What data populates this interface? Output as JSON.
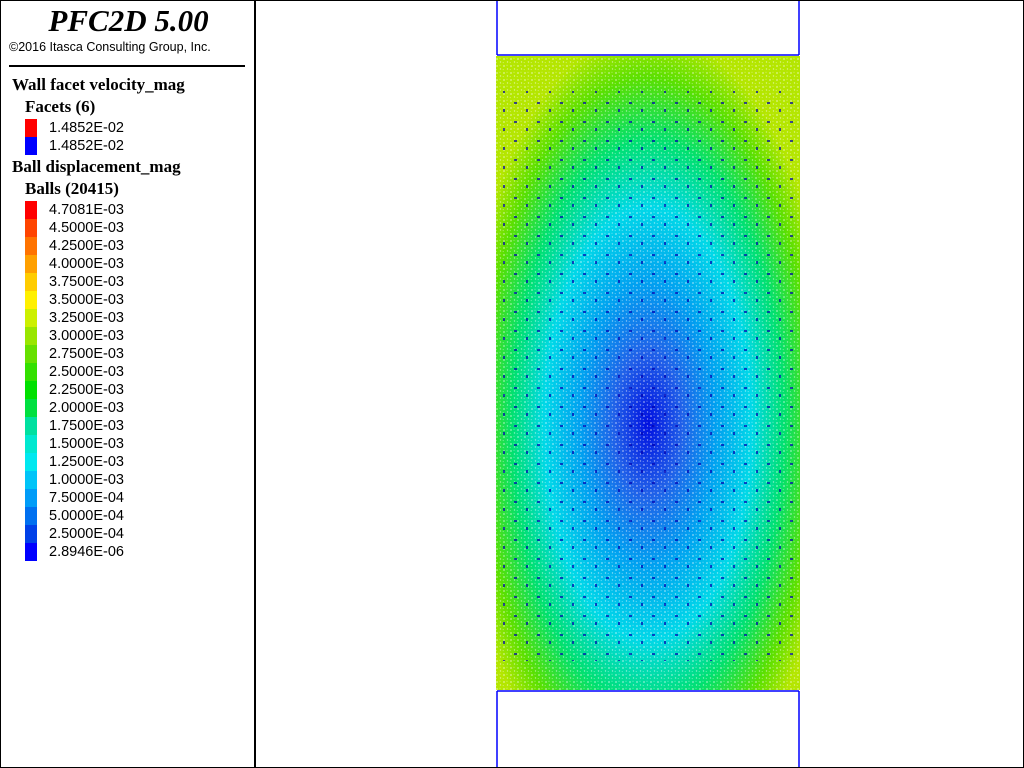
{
  "app": {
    "title": "PFC2D 5.00",
    "copyright": "©2016 Itasca Consulting Group, Inc."
  },
  "legend": {
    "wall_header": "Wall facet velocity_mag",
    "facets_header": "Facets (6)",
    "facet_items": [
      {
        "label": "1.4852E-02",
        "color": "#ff0000"
      },
      {
        "label": "1.4852E-02",
        "color": "#0000ff"
      }
    ],
    "ball_header": "Ball displacement_mag",
    "balls_header": "Balls (20415)",
    "ball_items": [
      {
        "label": "4.7081E-03",
        "color": "#ff0000"
      },
      {
        "label": "4.5000E-03",
        "color": "#ff4400"
      },
      {
        "label": "4.2500E-03",
        "color": "#ff7300"
      },
      {
        "label": "4.0000E-03",
        "color": "#ffa000"
      },
      {
        "label": "3.7500E-03",
        "color": "#ffcc00"
      },
      {
        "label": "3.5000E-03",
        "color": "#fff000"
      },
      {
        "label": "3.2500E-03",
        "color": "#ccf000"
      },
      {
        "label": "3.0000E-03",
        "color": "#99e600"
      },
      {
        "label": "2.7500E-03",
        "color": "#66e000"
      },
      {
        "label": "2.5000E-03",
        "color": "#33e000"
      },
      {
        "label": "2.2500E-03",
        "color": "#00e000"
      },
      {
        "label": "2.0000E-03",
        "color": "#00e040"
      },
      {
        "label": "1.7500E-03",
        "color": "#00e0a0"
      },
      {
        "label": "1.5000E-03",
        "color": "#00e8d0"
      },
      {
        "label": "1.2500E-03",
        "color": "#00e8f0"
      },
      {
        "label": "1.0000E-03",
        "color": "#00c4f8"
      },
      {
        "label": "7.5000E-04",
        "color": "#009cf8"
      },
      {
        "label": "5.0000E-04",
        "color": "#0070f0"
      },
      {
        "label": "2.5000E-04",
        "color": "#0040e8"
      },
      {
        "label": "2.8946E-06",
        "color": "#0000ff"
      }
    ]
  },
  "plot": {
    "specimen_colors": [
      "#b4e600",
      "#5ae000",
      "#00e070",
      "#00d8e8",
      "#00a0f0",
      "#2060e8",
      "#0010e0"
    ],
    "platen_color": "#0000ff"
  }
}
